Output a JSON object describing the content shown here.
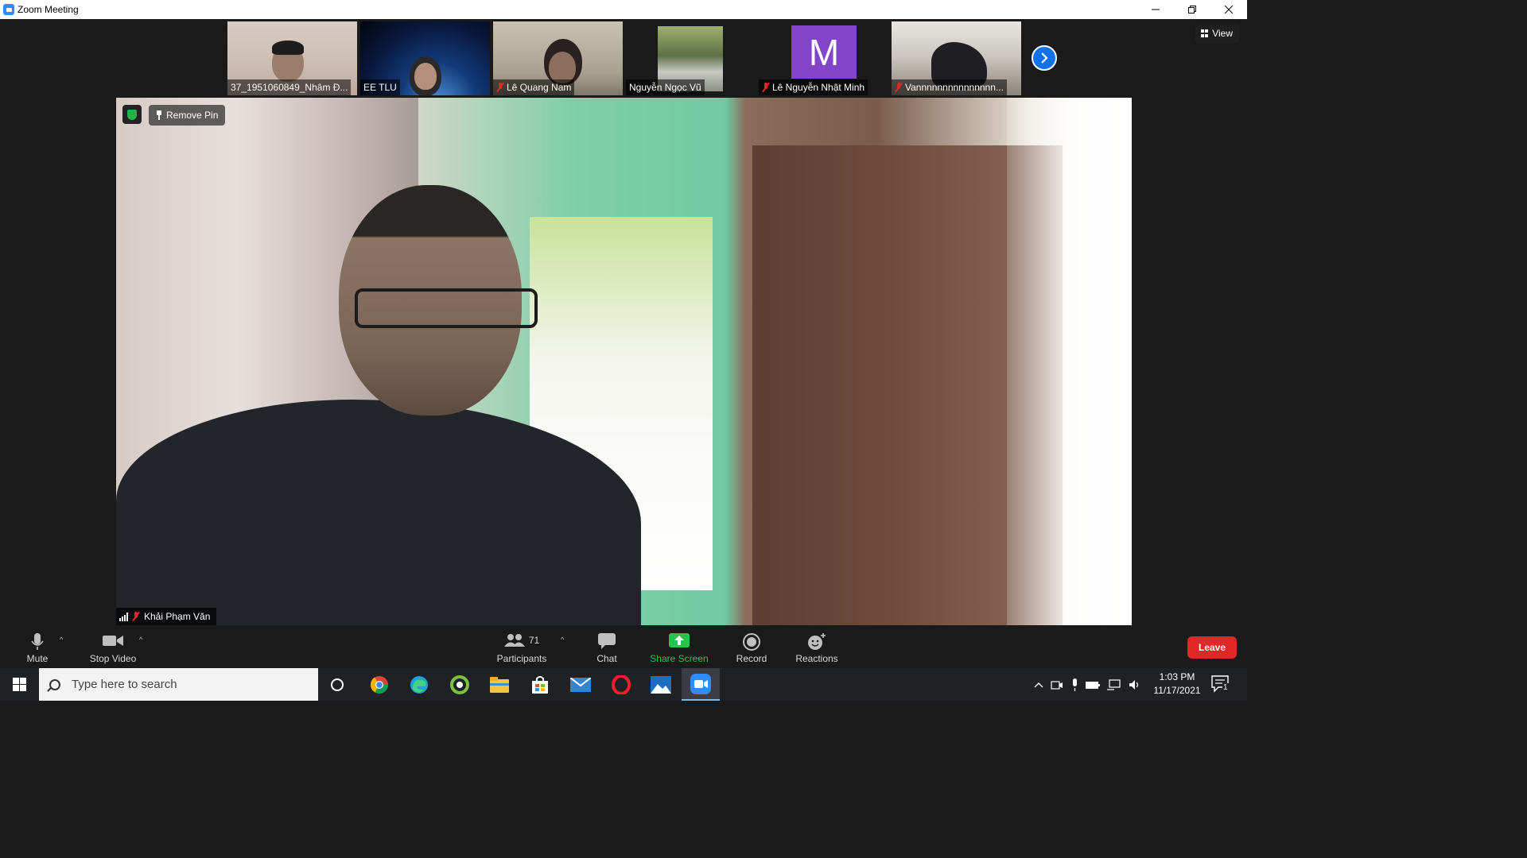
{
  "window": {
    "title": "Zoom Meeting"
  },
  "view_button": {
    "label": "View"
  },
  "thumbnails": [
    {
      "name": "37_1951060849_Nhâm Đ...",
      "muted": false
    },
    {
      "name": "EE TLU",
      "muted": false
    },
    {
      "name": "Lê Quang Nam",
      "muted": true
    },
    {
      "name": "Nguyễn Ngọc Vũ",
      "muted": false
    },
    {
      "name": "Lê Nguyễn Nhật Minh",
      "muted": true,
      "avatar_letter": "M"
    },
    {
      "name": "Vannnnnnnnnnnnnnn...",
      "muted": true
    }
  ],
  "main_video": {
    "remove_pin_label": "Remove Pin",
    "speaker_name": "Khải Phạm Văn",
    "muted": true
  },
  "toolbar": {
    "mute_label": "Mute",
    "stop_video_label": "Stop Video",
    "participants_label": "Participants",
    "participants_count": "71",
    "chat_label": "Chat",
    "share_screen_label": "Share Screen",
    "record_label": "Record",
    "reactions_label": "Reactions",
    "leave_label": "Leave"
  },
  "taskbar": {
    "search_placeholder": "Type here to search",
    "time": "1:03 PM",
    "date": "11/17/2021",
    "notification_count": "1"
  },
  "colors": {
    "zoom_blue": "#0e72ed",
    "share_green": "#24c54b",
    "leave_red": "#e02828",
    "muted_red": "#e02828",
    "avatar_purple": "#8245c9"
  }
}
